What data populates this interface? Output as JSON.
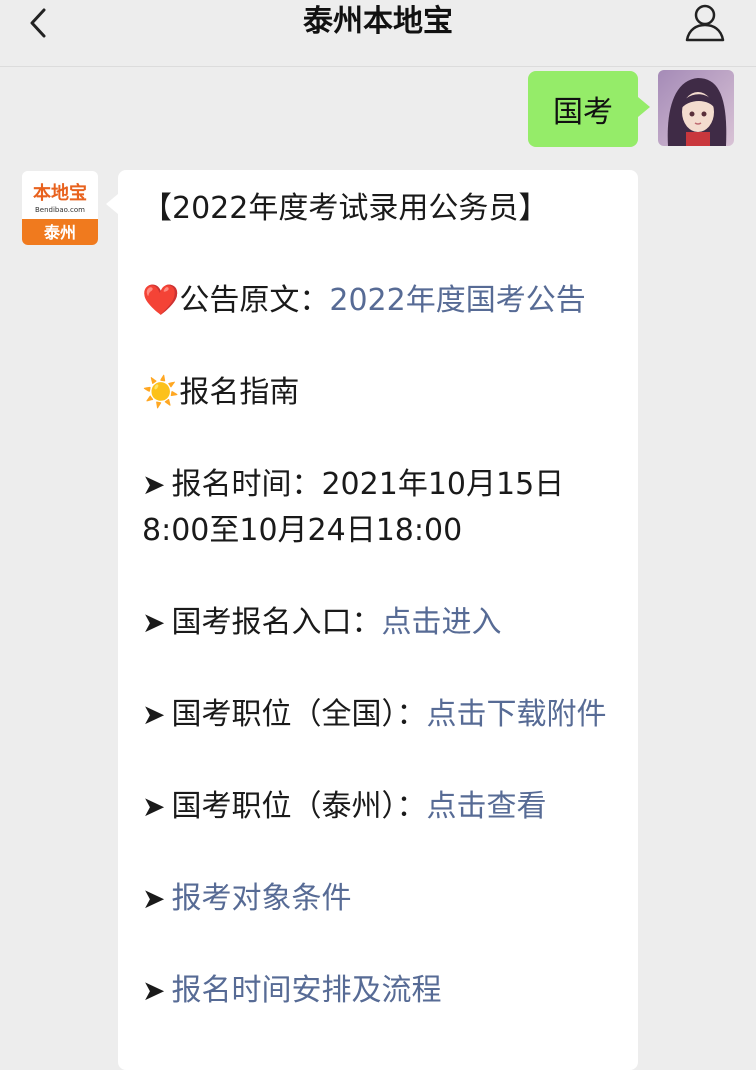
{
  "nav": {
    "title": "泰州本地宝"
  },
  "outgoing": {
    "text": "国考"
  },
  "incoming": {
    "avatar_logo_top": "本地宝",
    "avatar_logo_url": "Bendibao.com",
    "avatar_logo_city": "泰州",
    "header": "【2022年度考试录用公务员】",
    "announcement_label": "公告原文：",
    "announcement_link": "2022年度国考公告",
    "guide_label": "报名指南",
    "time_label": "报名时间：2021年10月15日8:00至10月24日18:00",
    "entry_label": "国考报名入口：",
    "entry_link": "点击进入",
    "pos_national_label": "国考职位（全国）：",
    "pos_national_link": "点击下载附件",
    "pos_taizhou_label": "国考职位（泰州）：",
    "pos_taizhou_link": "点击查看",
    "conditions_link": "报考对象条件",
    "schedule_link": "报名时间安排及流程"
  },
  "icons": {
    "back": "chevron-left-icon",
    "user": "person-icon",
    "heart": "red-heart-icon",
    "sun": "sun-icon",
    "arrow": "arrow-right-icon"
  },
  "colors": {
    "link": "#576b95",
    "outgoing_bubble": "#95ec69",
    "background": "#ededed"
  }
}
